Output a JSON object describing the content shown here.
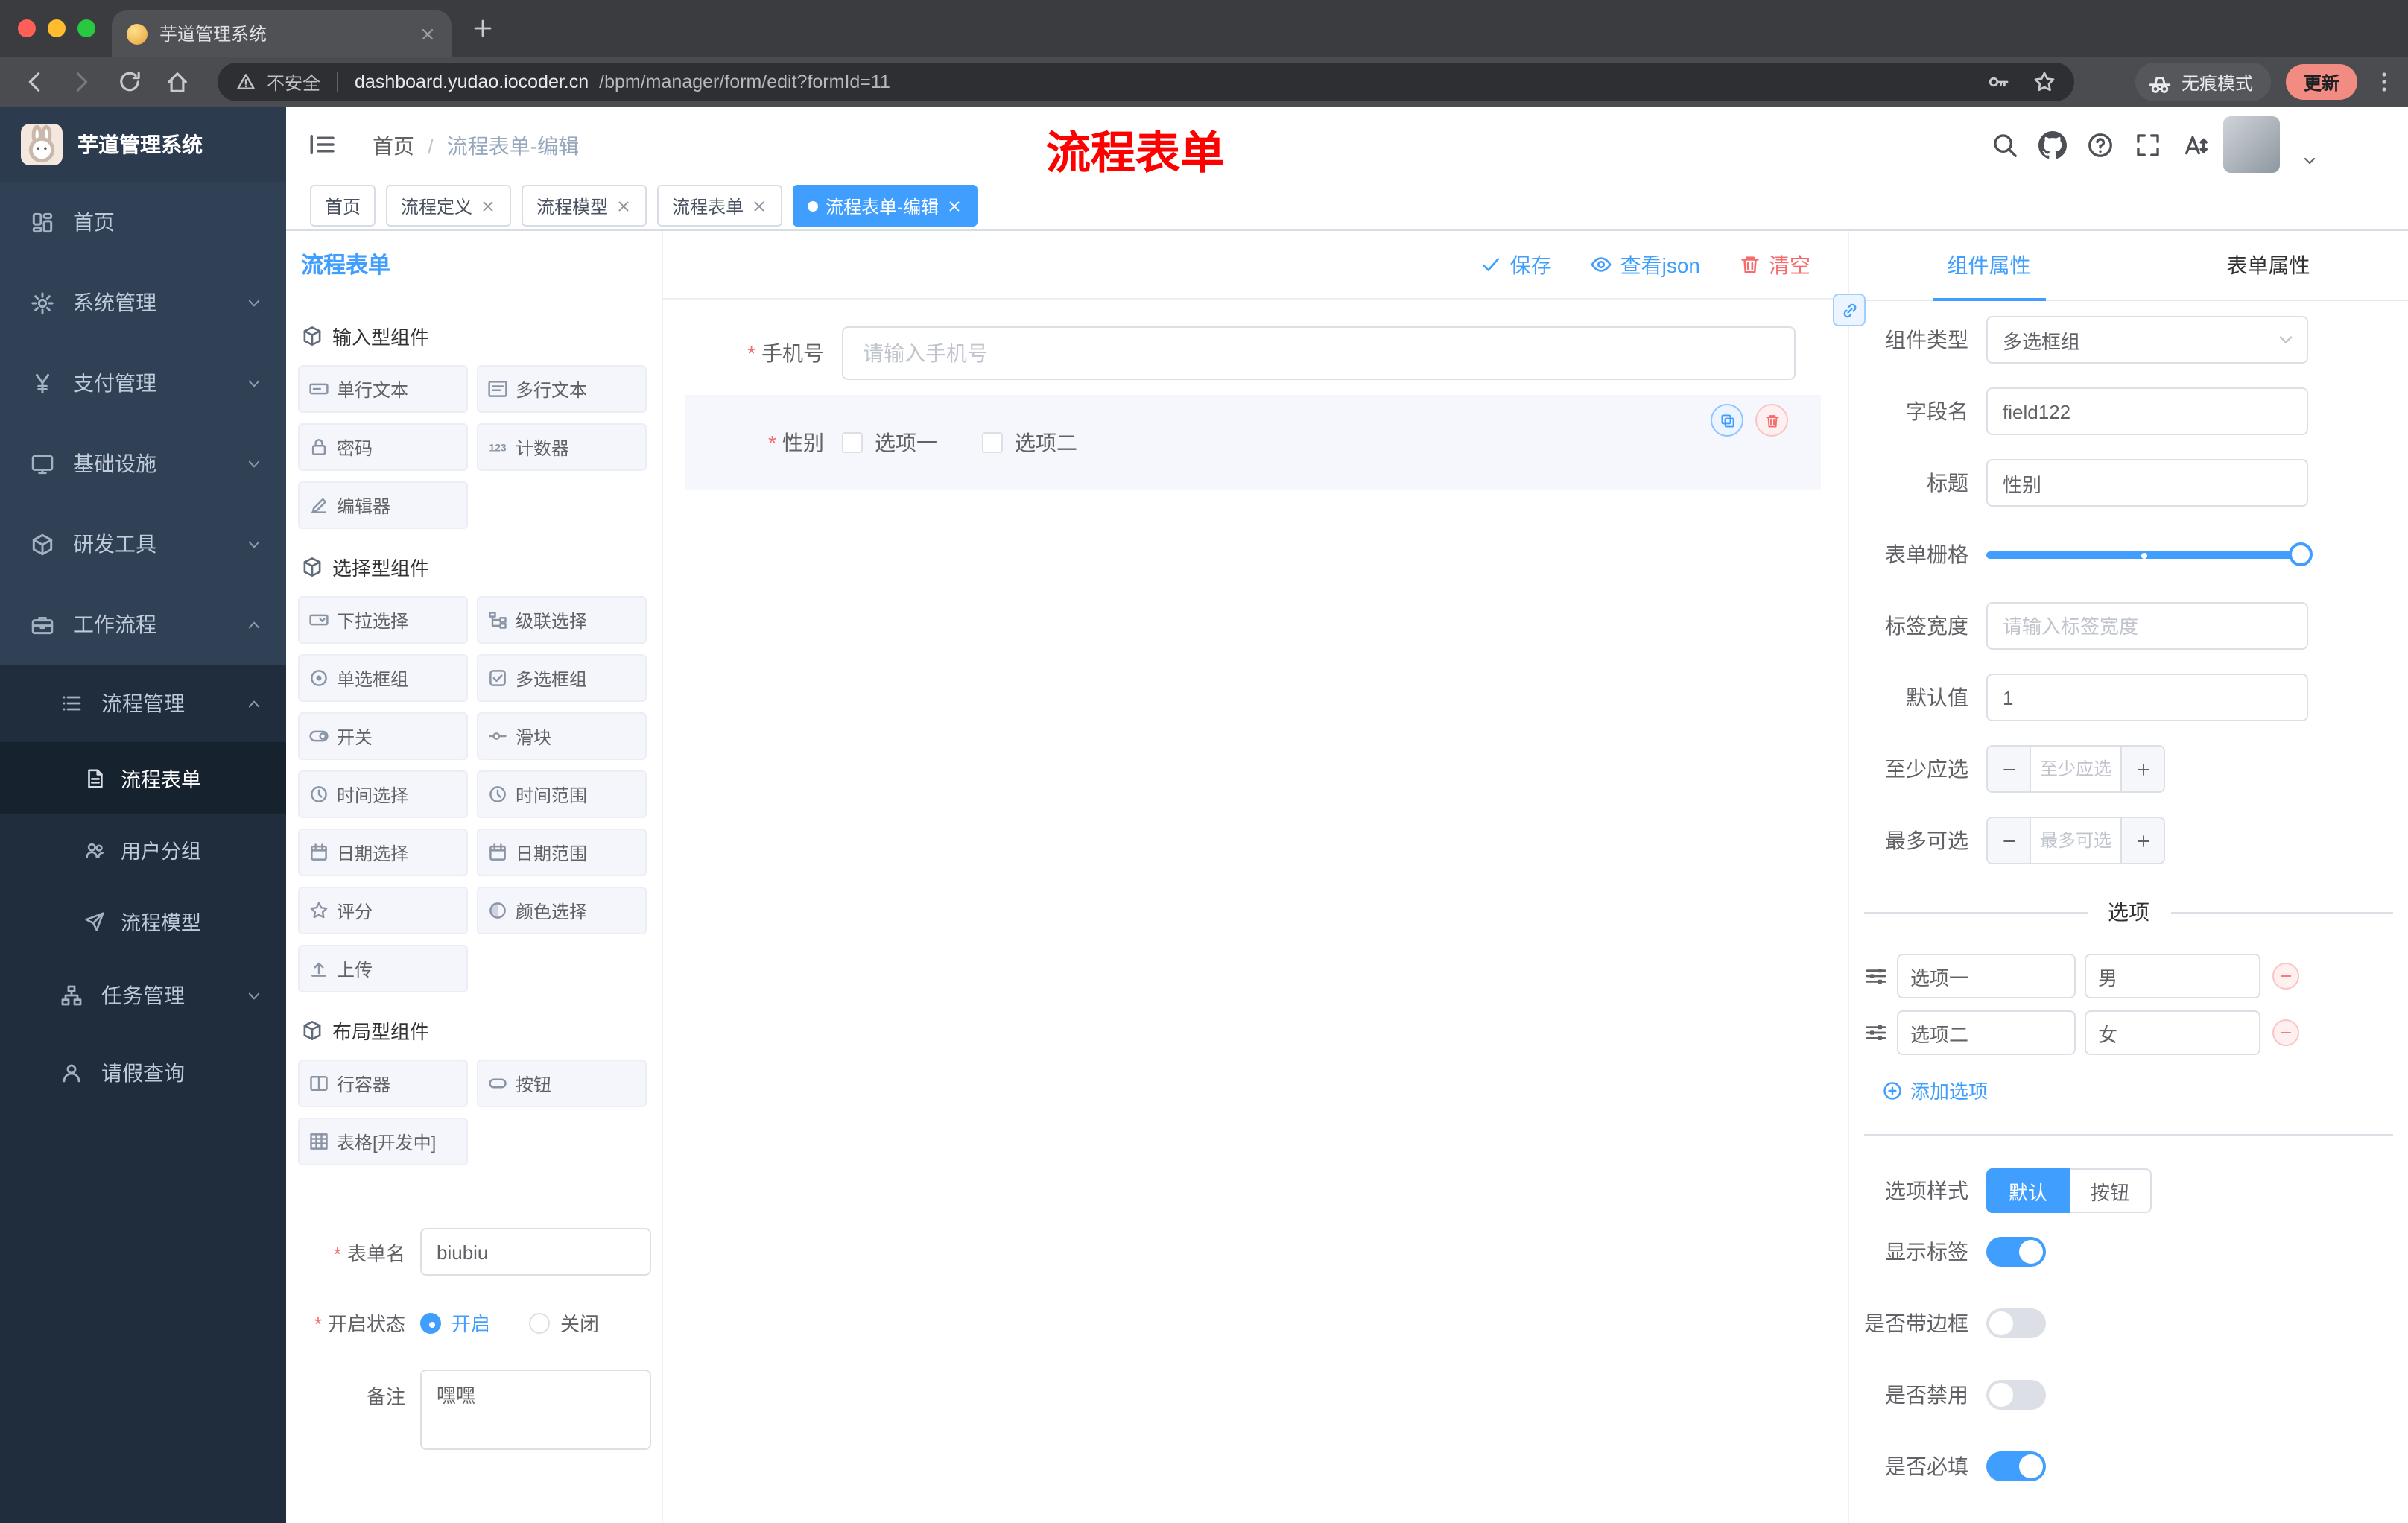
{
  "browser": {
    "tab_title": "芋道管理系统",
    "security_label": "不安全",
    "url_domain": "dashboard.yudao.iocoder.cn",
    "url_path": "/bpm/manager/form/edit?formId=11",
    "incognito_label": "无痕模式",
    "update_label": "更新"
  },
  "annotation": {
    "text": "流程表单",
    "color": "#ff0000"
  },
  "icons": {
    "browser": [
      "back-icon",
      "forward-icon",
      "reload-icon",
      "home-icon",
      "warning-icon",
      "key-icon",
      "star-icon",
      "incognito-icon",
      "more-vertical-icon",
      "close-icon",
      "new-tab-icon"
    ],
    "header": [
      "hamburger-fold-icon",
      "search-icon",
      "github-icon",
      "question-icon",
      "fullscreen-icon",
      "font-size-icon"
    ],
    "canvas_actions": [
      "check-icon",
      "eye-icon",
      "trash-icon",
      "copy-icon"
    ]
  },
  "sidebar": {
    "logo_title": "芋道管理系统",
    "menu": [
      {
        "label": "首页",
        "icon": "dashboard"
      },
      {
        "label": "系统管理",
        "icon": "gear"
      },
      {
        "label": "支付管理",
        "icon": "yen"
      },
      {
        "label": "基础设施",
        "icon": "monitor"
      },
      {
        "label": "研发工具",
        "icon": "box"
      },
      {
        "label": "工作流程",
        "icon": "briefcase"
      }
    ],
    "submenu": [
      {
        "label": "流程管理",
        "icon": "list"
      },
      {
        "label": "流程表单",
        "icon": "doc",
        "active": true
      },
      {
        "label": "用户分组",
        "icon": "users"
      },
      {
        "label": "流程模型",
        "icon": "send"
      },
      {
        "label": "任务管理",
        "icon": "tree"
      },
      {
        "label": "请假查询",
        "icon": "user"
      }
    ]
  },
  "header": {
    "breadcrumb_home": "首页",
    "separator": "/",
    "breadcrumb_current": "流程表单-编辑"
  },
  "tags": [
    {
      "label": "首页",
      "closable": false,
      "active": false
    },
    {
      "label": "流程定义",
      "closable": true,
      "active": false
    },
    {
      "label": "流程模型",
      "closable": true,
      "active": false
    },
    {
      "label": "流程表单",
      "closable": true,
      "active": false
    },
    {
      "label": "流程表单-编辑",
      "closable": true,
      "active": true
    }
  ],
  "palette": {
    "title": "流程表单",
    "groups": [
      {
        "title": "输入型组件",
        "items": [
          "单行文本",
          "多行文本",
          "密码",
          "计数器",
          "编辑器"
        ]
      },
      {
        "title": "选择型组件",
        "items": [
          "下拉选择",
          "级联选择",
          "单选框组",
          "多选框组",
          "开关",
          "滑块",
          "时间选择",
          "时间范围",
          "日期选择",
          "日期范围",
          "评分",
          "颜色选择",
          "上传"
        ]
      },
      {
        "title": "布局型组件",
        "items": [
          "行容器",
          "按钮",
          "表格[开发中]"
        ]
      }
    ],
    "form": {
      "name_label": "表单名",
      "name_value": "biubiu",
      "status_label": "开启状态",
      "status_on": "开启",
      "status_off": "关闭",
      "remark_label": "备注",
      "remark_value": "嘿嘿"
    }
  },
  "canvas": {
    "save": "保存",
    "view_json": "查看json",
    "clear": "清空",
    "phone": {
      "label": "手机号",
      "placeholder": "请输入手机号",
      "required": true
    },
    "gender": {
      "label": "性别",
      "required": true,
      "options": [
        "选项一",
        "选项二"
      ]
    }
  },
  "props": {
    "tab_component": "组件属性",
    "tab_form": "表单属性",
    "rows": {
      "type_label": "组件类型",
      "type_value": "多选框组",
      "field_label": "字段名",
      "field_value": "field122",
      "title_label": "标题",
      "title_value": "性别",
      "grid_label": "表单栅格",
      "width_label": "标签宽度",
      "width_placeholder": "请输入标签宽度",
      "default_label": "默认值",
      "default_value": "1",
      "min_label": "至少应选",
      "min_placeholder": "至少应选",
      "max_label": "最多可选",
      "max_placeholder": "最多可选"
    },
    "options_divider": "选项",
    "options": [
      {
        "label": "选项一",
        "value": "男"
      },
      {
        "label": "选项二",
        "value": "女"
      }
    ],
    "add_option": "添加选项",
    "style_label": "选项样式",
    "style_default": "默认",
    "style_button": "按钮",
    "switches": [
      {
        "label": "显示标签",
        "on": true
      },
      {
        "label": "是否带边框",
        "on": false
      },
      {
        "label": "是否禁用",
        "on": false
      },
      {
        "label": "是否必填",
        "on": true
      }
    ]
  },
  "colors": {
    "accent": "#409eff",
    "danger": "#f56c6c",
    "annotation_red": "#fe0000",
    "update_chip": "#f28b82",
    "sidebar_dark": "#1f2d3d",
    "sidebar_item": "#304156"
  }
}
